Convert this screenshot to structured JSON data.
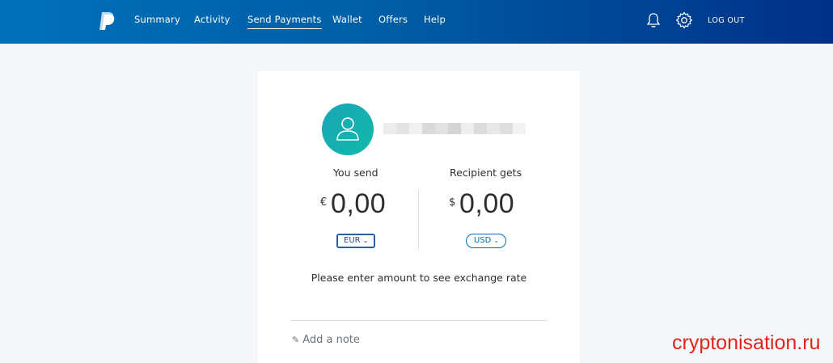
{
  "header": {
    "logo": "paypal-logo",
    "nav": [
      "Summary",
      "Activity",
      "Send Payments",
      "Wallet",
      "Offers",
      "Help"
    ],
    "active_nav": "Send Payments",
    "notifications_icon": "bell-icon",
    "settings_icon": "gear-icon",
    "logout_label": "LOG OUT"
  },
  "send_form": {
    "recipient_avatar_icon": "person-icon",
    "you_send": {
      "label": "You send",
      "symbol": "€",
      "amount": "0,00",
      "currency": "EUR"
    },
    "recipient_gets": {
      "label": "Recipient gets",
      "symbol": "$",
      "amount": "0,00",
      "currency": "USD"
    },
    "rate_message": "Please enter amount to see exchange rate",
    "note_label": "Add a note"
  },
  "watermark": "cryptonisation.ru",
  "colors": {
    "header_start": "#0070ba",
    "header_end": "#003087",
    "avatar": "#10b9a8",
    "link": "#0070ba",
    "watermark": "#e0251b"
  }
}
